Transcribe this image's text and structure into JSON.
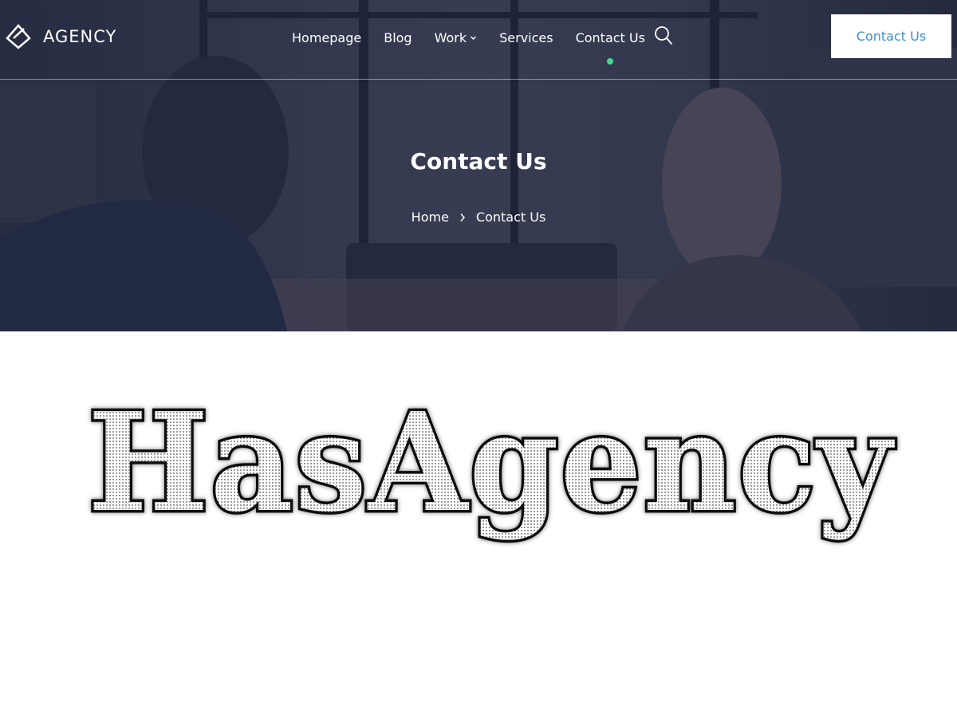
{
  "header": {
    "logo_text": "AGENCY",
    "nav": [
      {
        "label": "Homepage"
      },
      {
        "label": "Blog"
      },
      {
        "label": "Work"
      },
      {
        "label": "Services"
      },
      {
        "label": "Contact Us"
      }
    ],
    "active_index": 4,
    "cta_label": "Contact Us"
  },
  "hero": {
    "title": "Contact Us",
    "breadcrumb": {
      "home": "Home",
      "current": "Contact Us"
    }
  },
  "brand_text": "HasAgency",
  "colors": {
    "active_dot": "#4bd58c",
    "cta_text": "#3d8fcf",
    "overlay": "#1e243c"
  }
}
